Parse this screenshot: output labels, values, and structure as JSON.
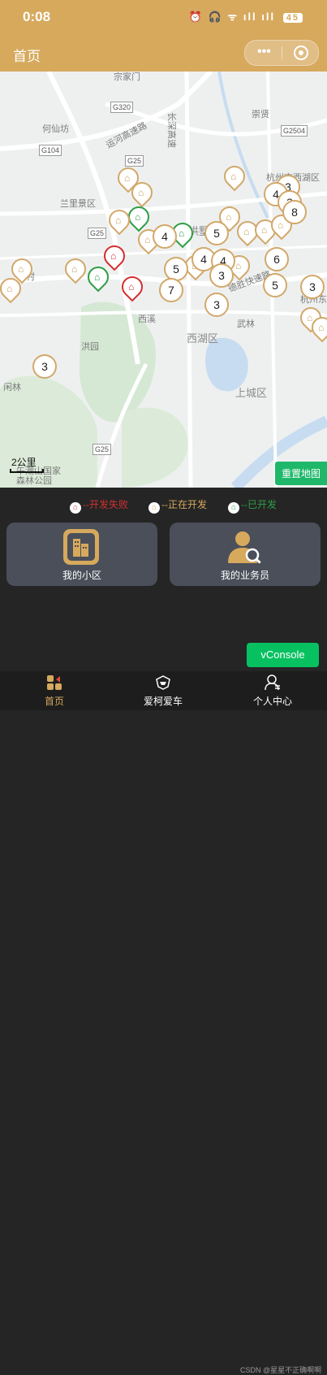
{
  "status": {
    "time": "0:08",
    "icons": "⏰ 🎧 ᯤ ıll ıll",
    "battery": "45"
  },
  "navbar": {
    "title": "首页",
    "more_icon": "more-dots-icon",
    "target_icon": "target-icon"
  },
  "map": {
    "labels": [
      {
        "text": "何仙坊"
      },
      {
        "text": "运河高速路"
      },
      {
        "text": "兰里景区"
      },
      {
        "text": "长深高速"
      },
      {
        "text": "崇贤"
      },
      {
        "text": "杭州市西湖区"
      },
      {
        "text": "拱墅"
      },
      {
        "text": "德胜快速路"
      },
      {
        "text": "西溪"
      },
      {
        "text": "西湖区"
      },
      {
        "text": "武林"
      },
      {
        "text": "上城区"
      },
      {
        "text": "洪园"
      },
      {
        "text": "闲林"
      },
      {
        "text": "午潮山国家森林公园"
      },
      {
        "text": "杭州东"
      },
      {
        "text": "村"
      },
      {
        "text": "宗家门"
      }
    ],
    "road_shields": [
      "G320",
      "G104",
      "G25",
      "G25",
      "G2504",
      "G25"
    ],
    "clusters": [
      "3",
      "4",
      "3",
      "8",
      "4",
      "5",
      "5",
      "4",
      "4",
      "6",
      "3",
      "7",
      "5",
      "3",
      "3",
      "3"
    ],
    "reset_label": "重置地图",
    "scale_label": "2公里"
  },
  "legend": [
    {
      "label": "--开发失败",
      "color": "#d32f2f"
    },
    {
      "label": "--正在开发",
      "color": "#d6a95d"
    },
    {
      "label": "--已开发",
      "color": "#2e9e44"
    }
  ],
  "cards": {
    "community": {
      "label": "我的小区",
      "icon": "building-icon"
    },
    "salesman": {
      "label": "我的业务员",
      "icon": "person-search-icon"
    }
  },
  "vconsole": "vConsole",
  "tabs": [
    {
      "label": "首页",
      "icon": "home-grid-icon"
    },
    {
      "label": "爱柯爱车",
      "icon": "car-logo-icon"
    },
    {
      "label": "个人中心",
      "icon": "user-icon"
    }
  ],
  "watermark": "CSDN @星星不正确啊啊",
  "colors": {
    "brand": "#d6a95d",
    "failed": "#d32f2f",
    "developing": "#d6a95d",
    "developed": "#2e9e44",
    "reset": "#1fb86a"
  }
}
